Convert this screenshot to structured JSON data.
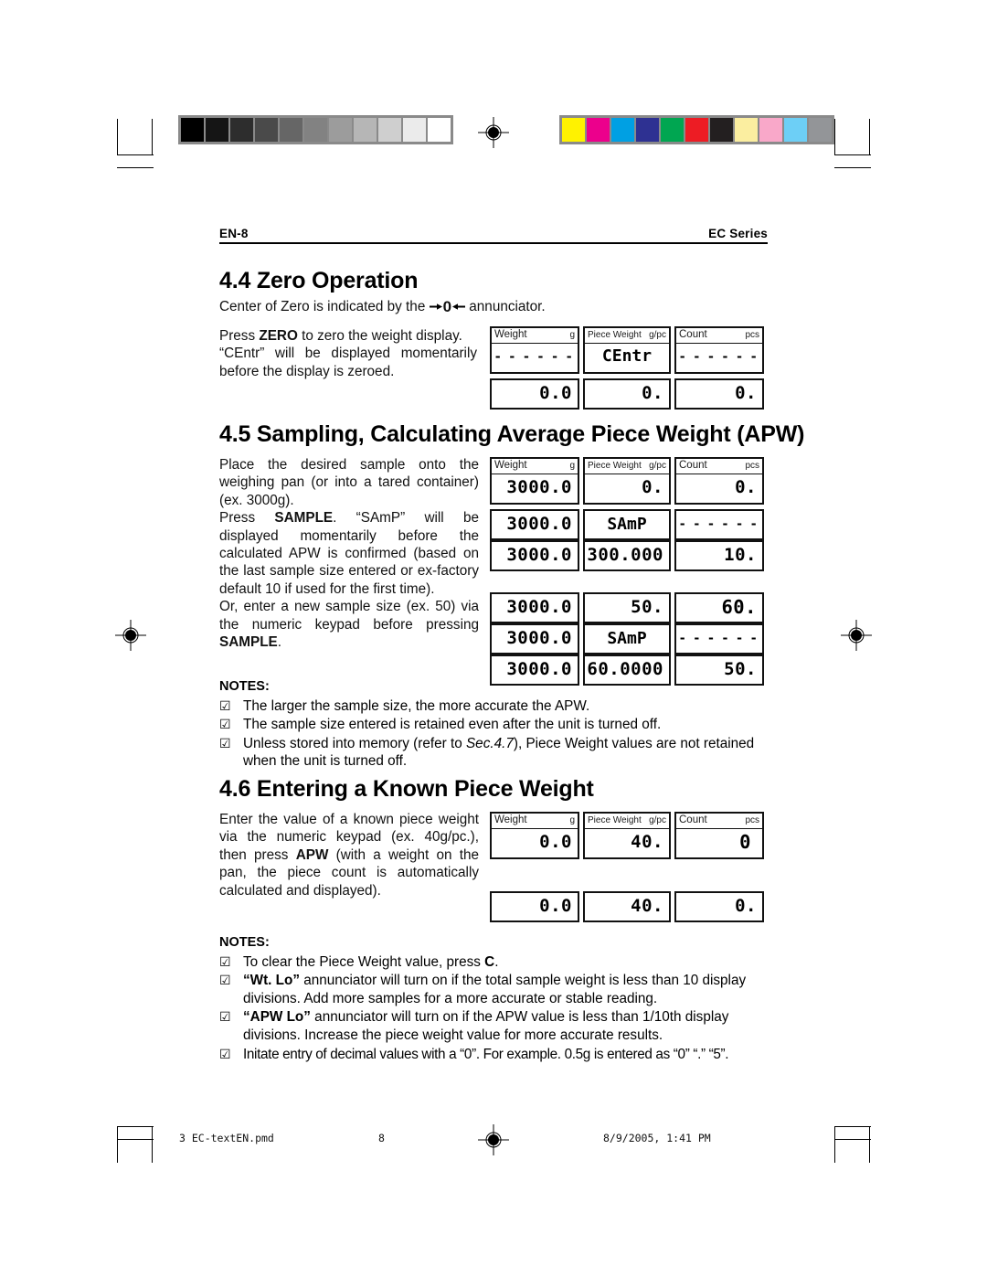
{
  "page": {
    "running_head_left": "EN-8",
    "running_head_right": "EC Series"
  },
  "sections": {
    "s44": {
      "heading": "4.4 Zero Operation",
      "intro_before": "Center of Zero is indicated by the",
      "intro_after": "annunciator.",
      "annunciator_icon": "center-of-zero-icon",
      "annunciator_symbol": "0",
      "para1_a": "Press ",
      "para1_b": "ZERO",
      "para1_c": " to zero the weight display.",
      "para2": "“CEntr” will be displayed momentarily before the display is zeroed."
    },
    "s45": {
      "heading": "4.5 Sampling, Calculating Average Piece Weight (APW)",
      "para1": "Place the desired sample onto the weighing pan (or into a tared container) (ex. 3000g).",
      "para2_a": "Press ",
      "para2_b": "SAMPLE",
      "para2_c": ".  “SAmP” will be displayed momentarily before the calculated APW is confirmed (based on the last sample size entered or ex-factory default 10 if used for the first time).",
      "para3_a": "Or, enter a new sample size (ex. 50) via the numeric keypad before pressing ",
      "para3_b": "SAMPLE",
      "para3_c": ".",
      "notes_title": "NOTES",
      "notes": [
        "The larger the sample size, the more accurate the APW.",
        "The sample size entered is retained even after the unit is turned off.",
        "Unless stored into memory (refer to Sec.4.7), Piece Weight values are not retained when the unit is turned off."
      ],
      "note3_pre": "Unless stored into memory (refer to ",
      "note3_italic": "Sec.4.7",
      "note3_post": "), Piece Weight values are not retained when the unit is turned off."
    },
    "s46": {
      "heading": "4.6 Entering a Known Piece Weight",
      "para1_a": "Enter the value of a known piece weight via the numeric keypad (ex. 40g/pc.), then press ",
      "para1_b": "APW",
      "para1_c": " (with a weight on the pan, the piece count is automatically calculated and displayed).",
      "notes_title": "NOTES",
      "note1_pre": "To clear the Piece Weight value, press ",
      "note1_bold": "C",
      "note1_post": ".",
      "note2_bold": "“Wt. Lo”",
      "note2_post": " annunciator will turn on if the total sample weight is less than 10 display divisions.  Add more samples for a more accurate or stable reading.",
      "note3_bold": "“APW Lo”",
      "note3_post": " annunciator will turn on if the APW value is less than 1/10th display divisions.  Increase the piece weight value for more accurate results.",
      "note4": "Initate entry of decimal values with a “0”.  For example. 0.5g is entered as “0” “.” “5”."
    }
  },
  "lcd_labels": {
    "weight": "Weight",
    "weight_unit": "g",
    "piece_weight": "Piece Weight",
    "piece_weight_unit": "g/pc",
    "count": "Count",
    "count_unit": "pcs"
  },
  "lcd_groups": {
    "zero": [
      {
        "weight": "- - - - - -",
        "piece_weight": "CEntr",
        "count": "- - - - - -"
      },
      {
        "weight": "0.0",
        "piece_weight": "0.",
        "count": "0."
      }
    ],
    "sampling_a": [
      {
        "weight": "3000.0",
        "piece_weight": "0.",
        "count": "0."
      },
      {
        "weight": "3000.0",
        "piece_weight": "SAmP",
        "count": "- - - - - -"
      },
      {
        "weight": "3000.0",
        "piece_weight": "300.000",
        "count": "10."
      }
    ],
    "sampling_b": [
      {
        "weight": "3000.0",
        "piece_weight": "50.",
        "count": "60."
      },
      {
        "weight": "3000.0",
        "piece_weight": "SAmP",
        "count": "- - - - - -"
      },
      {
        "weight": "3000.0",
        "piece_weight": "60.0000",
        "count": "50."
      }
    ],
    "known_apw": [
      {
        "weight": "0.0",
        "piece_weight": "40.",
        "count": "0"
      },
      {
        "weight": "0.0",
        "piece_weight": "40.",
        "count": "0."
      }
    ]
  },
  "footer": {
    "file": "3 EC-textEN.pmd",
    "page_number": "8",
    "timestamp": "8/9/2005, 1:41 PM"
  },
  "print_marks": {
    "gray_steps": [
      "#000000",
      "#151515",
      "#2d2d2d",
      "#4a4a4a",
      "#666666",
      "#828282",
      "#9c9c9c",
      "#b6b6b6",
      "#cfcfcf",
      "#ebebeb",
      "#ffffff"
    ],
    "color_steps": [
      "#fff200",
      "#ec008c",
      "#00a0e3",
      "#2e3192",
      "#00a651",
      "#ed1c24",
      "#231f20",
      "#fbeea0",
      "#f9a8c9",
      "#6dcff6",
      "#939598"
    ]
  }
}
